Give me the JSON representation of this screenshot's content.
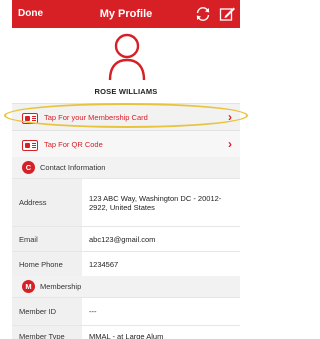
{
  "navbar": {
    "done_label": "Done",
    "title": "My Profile",
    "refresh_icon": "refresh-icon",
    "edit_icon": "edit-icon",
    "bg_color": "#d71f26"
  },
  "profile": {
    "avatar_icon": "user-avatar-icon",
    "name": "ROSE WILLIAMS"
  },
  "actions": {
    "membership_card_label": "Tap For your Membership Card",
    "qr_code_label": "Tap For QR Code"
  },
  "contact": {
    "badge": "C",
    "title": "Contact Information",
    "address_label": "Address",
    "address_value": "123 ABC Way, Washington DC - 20012-2922, United States",
    "email_label": "Email",
    "email_value": "abc123@gmail.com",
    "phone_label": "Home Phone",
    "phone_value": "1234567"
  },
  "membership": {
    "badge": "M",
    "title": "Membership",
    "member_id_label": "Member ID",
    "member_id_value": "---",
    "member_type_label": "Member Type",
    "member_type_value": "MMAL - at Large Alum"
  },
  "colors": {
    "accent": "#d71f26",
    "highlight": "#e8c43c"
  }
}
